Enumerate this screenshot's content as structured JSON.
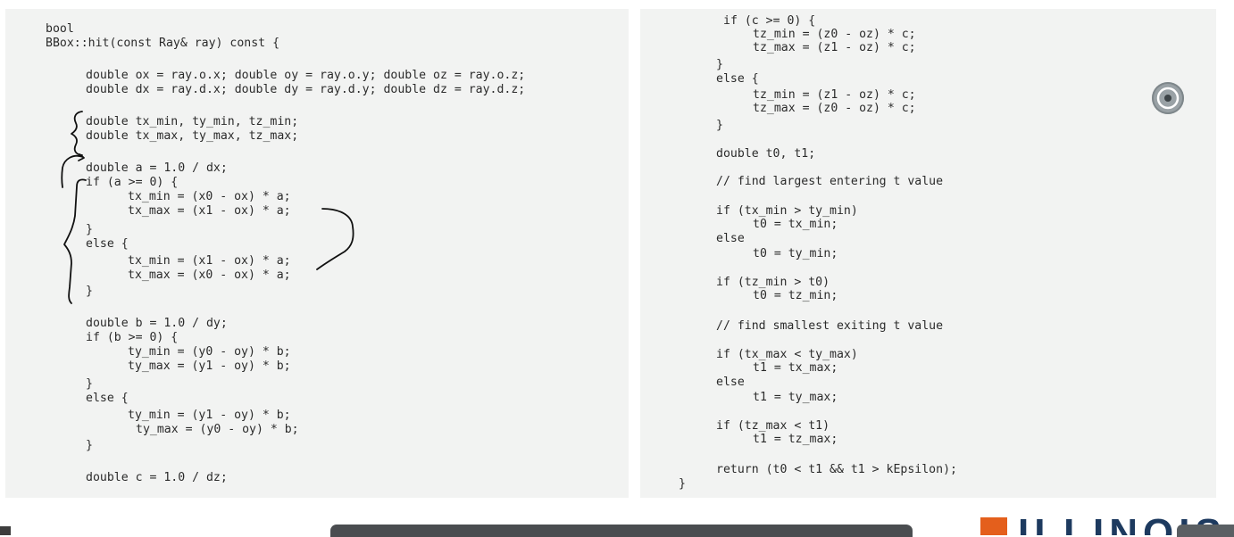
{
  "left_code": [
    "bool",
    "BBox::hit(const Ray& ray) const {",
    "double ox = ray.o.x; double oy = ray.o.y; double oz = ray.o.z;",
    "double dx = ray.d.x; double dy = ray.d.y; double dz = ray.d.z;",
    "double tx_min, ty_min, tz_min;",
    "double tx_max, ty_max, tz_max;",
    "double a = 1.0 / dx;",
    "if (a >= 0) {",
    "tx_min = (x0 - ox) * a;",
    "tx_max = (x1 - ox) * a;",
    "}",
    "else {",
    "tx_min = (x1 - ox) * a;",
    "tx_max = (x0 - ox) * a;",
    "}",
    "double b = 1.0 / dy;",
    "if (b >= 0) {",
    "ty_min = (y0 - oy) * b;",
    "ty_max = (y1 - oy) * b;",
    "}",
    "else {",
    "ty_min = (y1 - oy) * b;",
    "ty_max = (y0 - oy) * b;",
    "}",
    "double c = 1.0 / dz;"
  ],
  "right_code": [
    "if (c >= 0) {",
    "tz_min = (z0 - oz) * c;",
    "tz_max = (z1 - oz) * c;",
    "}",
    "else {",
    "tz_min = (z1 - oz) * c;",
    "tz_max = (z0 - oz) * c;",
    "}",
    "double t0, t1;",
    "// find largest entering t value",
    "if (tx_min > ty_min)",
    "t0 = tx_min;",
    "else",
    "t0 = ty_min;",
    "if (tz_min > t0)",
    "t0 = tz_min;",
    "// find smallest exiting t value",
    "if (tx_max < ty_max)",
    "t1 = tx_max;",
    "else",
    "t1 = ty_max;",
    "if (tz_max < t1)",
    "t1 = tz_max;",
    "return (t0 < t1 && t1 > kEpsilon);",
    "}"
  ],
  "logo": {
    "text": "ILLINOIS",
    "color": "#1d3a5f",
    "accent": "#e45f1c"
  },
  "icons": {
    "media_button": "target-icon"
  }
}
